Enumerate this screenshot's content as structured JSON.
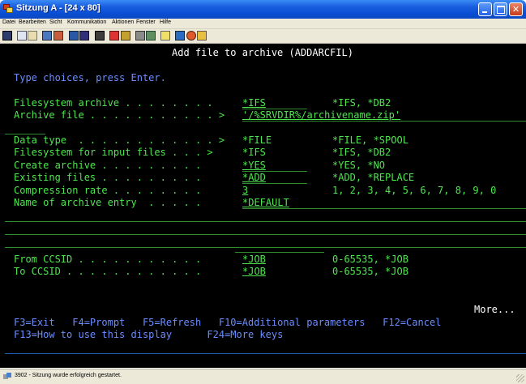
{
  "window": {
    "title": "Sitzung A - [24 x 80]",
    "controls": {
      "minimize": "minimize",
      "maximize": "maximize",
      "close": "✕"
    }
  },
  "menu": [
    {
      "label": "Datei"
    },
    {
      "label": "Bearbeiten"
    },
    {
      "label": "Sicht"
    },
    {
      "label": "Kommunikation"
    },
    {
      "label": "Aktionen"
    },
    {
      "label": "Fenster"
    },
    {
      "label": "Hilfe"
    }
  ],
  "toolbar": {
    "icons": [
      "print-screen-icon",
      "copy-icon",
      "paste-icon",
      "send-icon",
      "receive-icon",
      "display-icon",
      "keypad-icon",
      "session-icon",
      "macro-record-icon",
      "macro-play-icon",
      "macro-run-icon",
      "connect-icon",
      "disconnect-icon",
      "help-icon",
      "color-icon",
      "edit-icon"
    ]
  },
  "screen": {
    "title": "Add file to archive (ADDARCFIL)",
    "instruction": "Type choices, press Enter.",
    "fields": [
      {
        "label": "Filesystem archive . . . . . . . .",
        "value": "*IFS",
        "hint": "*IFS, *DB2"
      },
      {
        "label": "Archive file . . . . . . . . . . . >",
        "value": "'/%SRVDIR%/archivename.zip'",
        "hint": ""
      },
      {
        "label": "Data type  . . . . . . . . . . . . >",
        "value": "*FILE",
        "hint": "*FILE, *SPOOL"
      },
      {
        "label": "Filesystem for input files . . . >",
        "value": "*IFS",
        "hint": "*IFS, *DB2"
      },
      {
        "label": "Create archive . . . . . . . . .",
        "value": "*YES",
        "hint": "*YES, *NO"
      },
      {
        "label": "Existing files . . . . . . . . .",
        "value": "*ADD",
        "hint": "*ADD, *REPLACE"
      },
      {
        "label": "Compression rate . . . . . . . .",
        "value": "3",
        "hint": "1, 2, 3, 4, 5, 6, 7, 8, 9, 0"
      },
      {
        "label": "Name of archive entry  . . . . .",
        "value": "*DEFAULT",
        "hint": ""
      },
      {
        "label": "From CCSID . . . . . . . . . . .",
        "value": "*JOB",
        "hint": "0-65535, *JOB"
      },
      {
        "label": "To CCSID . . . . . . . . . . . .",
        "value": "*JOB",
        "hint": "0-65535, *JOB"
      }
    ],
    "more": "More...",
    "fkeys_row1": "F3=Exit   F4=Prompt   F5=Refresh   F10=Additional parameters   F12=Cancel",
    "fkeys_row2": "F13=How to use this display      F24=More keys"
  },
  "status": {
    "text": "3902 - Sitzung wurde erfolgreich gestartet."
  }
}
